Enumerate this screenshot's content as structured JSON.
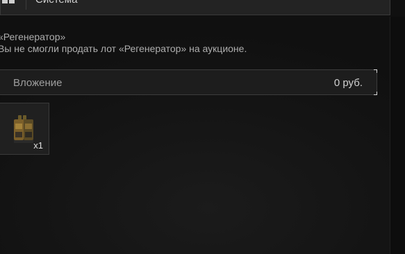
{
  "header": {
    "title": "Система",
    "icon": "system-icon"
  },
  "message": {
    "subject": "«Регенератор»",
    "body": "Вы не смогли продать лот «Регенератор» на аукционе."
  },
  "attachment": {
    "label": "Вложение",
    "value": "0 руб."
  },
  "item": {
    "icon": "regenerator-icon",
    "count": "x1"
  },
  "colors": {
    "background": "#141414",
    "panel": "#1d1d1d",
    "border": "#3c3c3c",
    "text": "#bdbdbd"
  }
}
